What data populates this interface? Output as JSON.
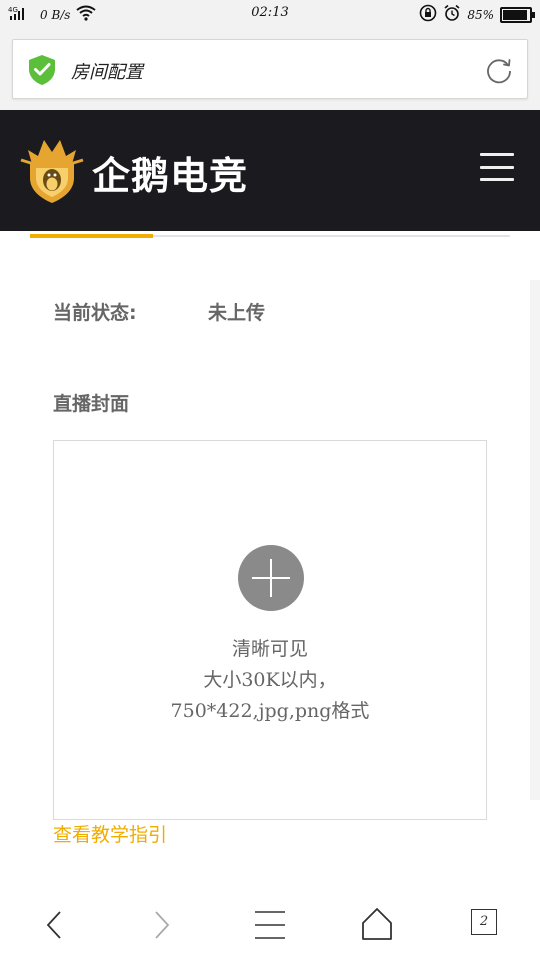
{
  "statusbar": {
    "network": "4G",
    "speed": "0 B/s",
    "time": "02:13",
    "battery": "85%",
    "battery_level": 0.85
  },
  "address": {
    "title": "房间配置",
    "secure_icon": "shield-check-icon",
    "reload_icon": "reload-icon"
  },
  "header": {
    "brand": "企鹅电竞",
    "logo_icon": "crowned-penguin-shield-icon",
    "menu_icon": "hamburger-menu-icon"
  },
  "content": {
    "status_label": "当前状态:",
    "status_value": "未上传",
    "cover_label": "直播封面",
    "upload_hint": [
      "清晰可见",
      "大小30K以内，",
      "750*422,jpg,png格式"
    ],
    "guide_link": "查看教学指引"
  },
  "bottom_nav": {
    "tab_count": "2",
    "items": [
      "back-icon",
      "forward-icon",
      "menu-icon",
      "home-icon",
      "tabs-icon"
    ]
  },
  "colors": {
    "accent": "#f0ad00",
    "header_bg": "#1b1b1f",
    "secure_green": "#5bbf3a"
  }
}
